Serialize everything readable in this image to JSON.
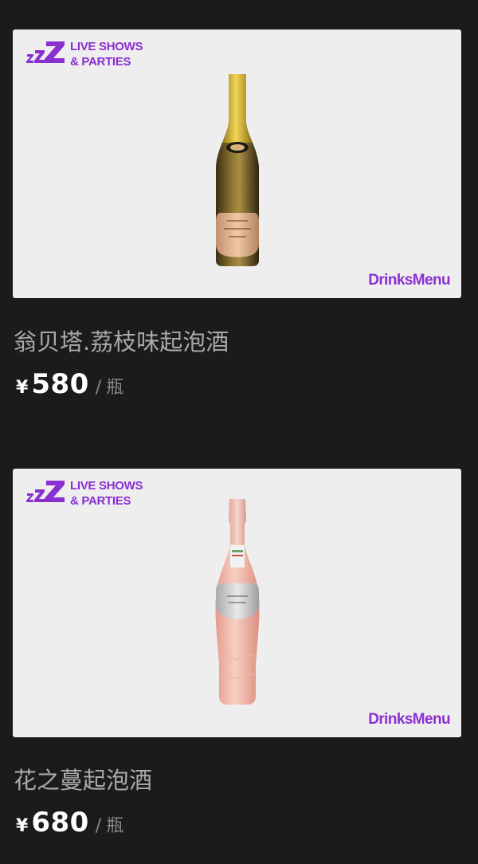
{
  "colors": {
    "background": "#1b1b1b",
    "card": "#efeeef",
    "brand_purple": "#8a2fd0",
    "name_text": "#a9a9a9",
    "price_text": "#ffffff",
    "unit_text": "#8a8a8a"
  },
  "products": [
    {
      "brand_line1": "LIVE SHOWS",
      "brand_line2": "& PARTIES",
      "menu_tag": "DrinksMenu",
      "name": "翁贝塔.荔枝味起泡酒",
      "currency": "¥",
      "price": "580",
      "separator": "/",
      "unit": "瓶",
      "image": "gold-champagne-bottle"
    },
    {
      "brand_line1": "LIVE SHOWS",
      "brand_line2": "& PARTIES",
      "menu_tag": "DrinksMenu",
      "name": "花之蔓起泡酒",
      "currency": "¥",
      "price": "680",
      "separator": "/",
      "unit": "瓶",
      "image": "rose-sparkling-wine-bottle"
    }
  ]
}
